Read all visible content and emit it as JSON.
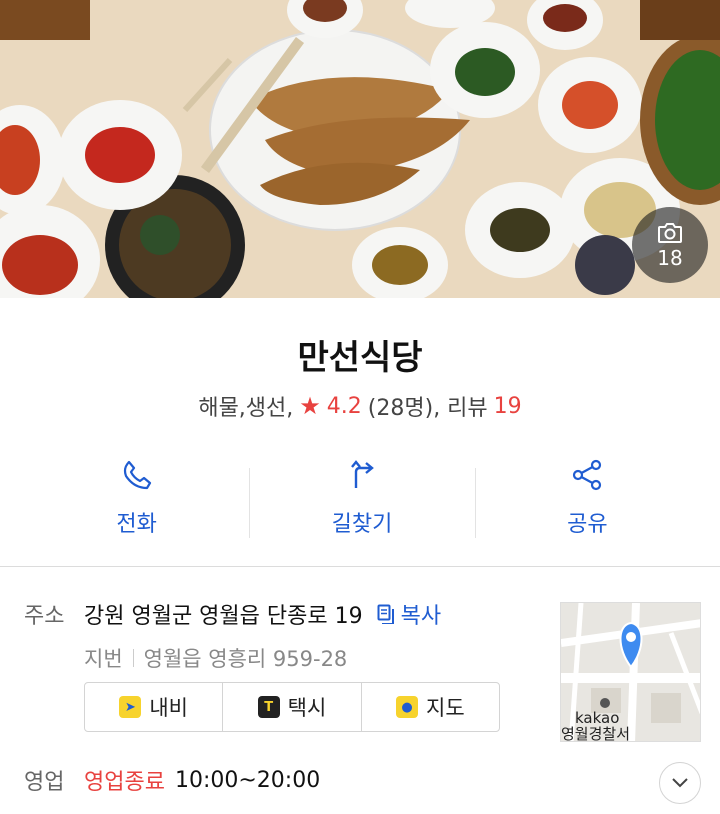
{
  "hero": {
    "photo_count": "18"
  },
  "place": {
    "name": "만선식당",
    "category": "해물,생선,",
    "rating": "4.2",
    "rating_count": "(28명), 리뷰",
    "review_count": "19"
  },
  "actions": [
    {
      "label": "전화",
      "icon": "phone-icon"
    },
    {
      "label": "길찾기",
      "icon": "directions-icon"
    },
    {
      "label": "공유",
      "icon": "share-icon"
    }
  ],
  "address": {
    "label": "주소",
    "road": "강원 영월군 영월읍 단종로 19",
    "copy_label": "복사",
    "jibun_label": "지번",
    "jibun": "영월읍 영흥리 959-28"
  },
  "nav_buttons": [
    {
      "label": "내비",
      "icon": "navi-icon"
    },
    {
      "label": "택시",
      "icon": "taxi-icon"
    },
    {
      "label": "지도",
      "icon": "map-pin-icon"
    }
  ],
  "minimap": {
    "brand": "kakao",
    "place_label": "영월경찰서"
  },
  "hours": {
    "label": "영업",
    "status": "영업종료",
    "time": "10:00~20:00"
  },
  "colors": {
    "accent": "#1f5cd1",
    "rating": "#e8423f"
  }
}
